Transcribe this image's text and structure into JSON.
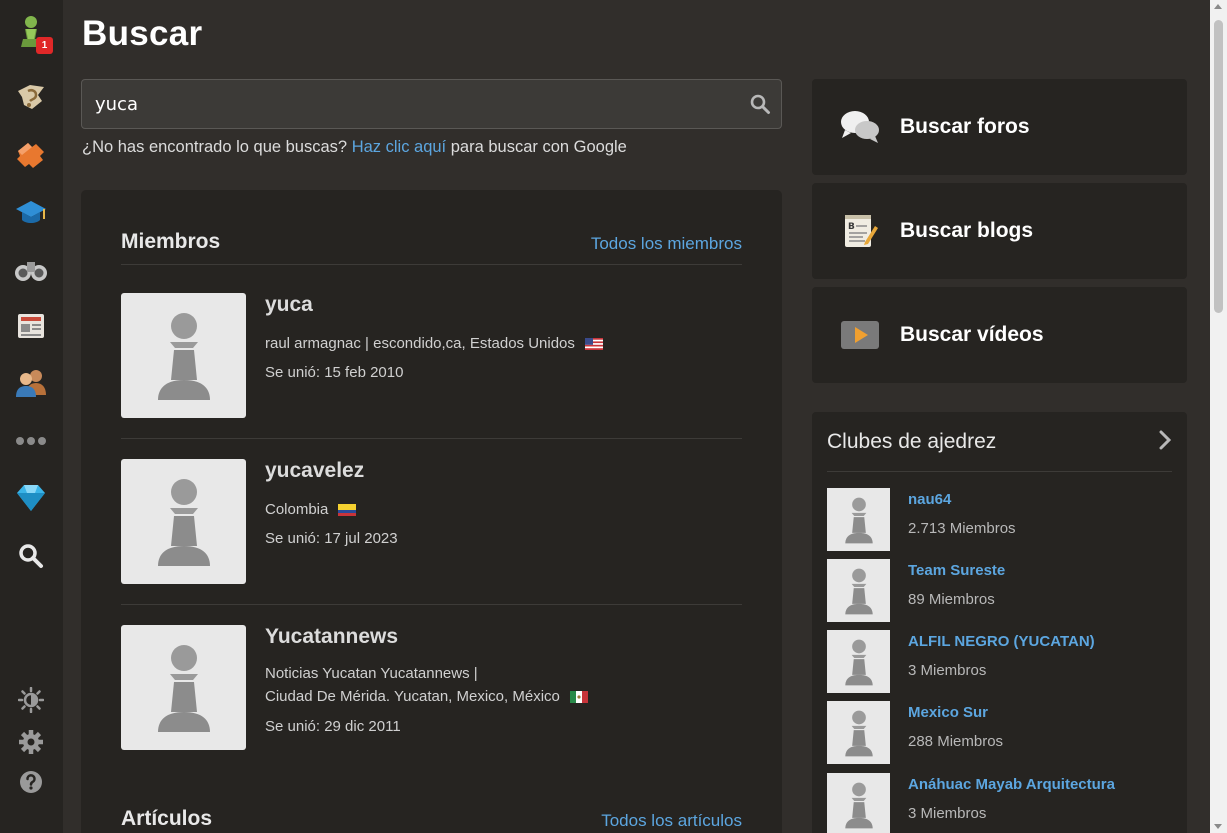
{
  "page": {
    "title": "Buscar"
  },
  "search": {
    "value": "yuca",
    "placeholder": ""
  },
  "hint": {
    "before": "¿No has encontrado lo que buscas?",
    "link": "Haz clic aquí",
    "after": " para buscar con Google"
  },
  "sidebar": {
    "notification_count": "1"
  },
  "members": {
    "title": "Miembros",
    "link": "Todos los miembros",
    "items": [
      {
        "name": "yuca",
        "line1": "raul armagnac  | escondido,ca, Estados Unidos",
        "line2": "",
        "joined": "Se unió: 15 feb 2010",
        "flag": "us"
      },
      {
        "name": "yucavelez",
        "line1": "Colombia",
        "line2": "",
        "joined": "Se unió: 17 jul 2023",
        "flag": "co"
      },
      {
        "name": "Yucatannews",
        "line1": "Noticias Yucatan Yucatannews  |",
        "line2": "Ciudad De Mérida. Yucatan, Mexico, México",
        "joined": "Se unió: 29 dic 2011",
        "flag": "mx"
      }
    ]
  },
  "articles": {
    "title": "Artículos",
    "link": "Todos los artículos"
  },
  "side_cards": {
    "forums": "Buscar foros",
    "blogs": "Buscar blogs",
    "videos": "Buscar vídeos"
  },
  "clubs": {
    "title": "Clubes de ajedrez",
    "items": [
      {
        "name": "nau64",
        "members": "2.713 Miembros"
      },
      {
        "name": "Team Sureste",
        "members": "89 Miembros"
      },
      {
        "name": "ALFIL NEGRO (YUCATAN)",
        "members": "3 Miembros"
      },
      {
        "name": "Mexico Sur",
        "members": "288 Miembros"
      },
      {
        "name": "Anáhuac Mayab Arquitectura",
        "members": "3 Miembros"
      }
    ]
  },
  "colors": {
    "link": "#5ca6e0",
    "background": "#312e2b",
    "panel": "#262421",
    "accent_green": "#81b64c"
  }
}
